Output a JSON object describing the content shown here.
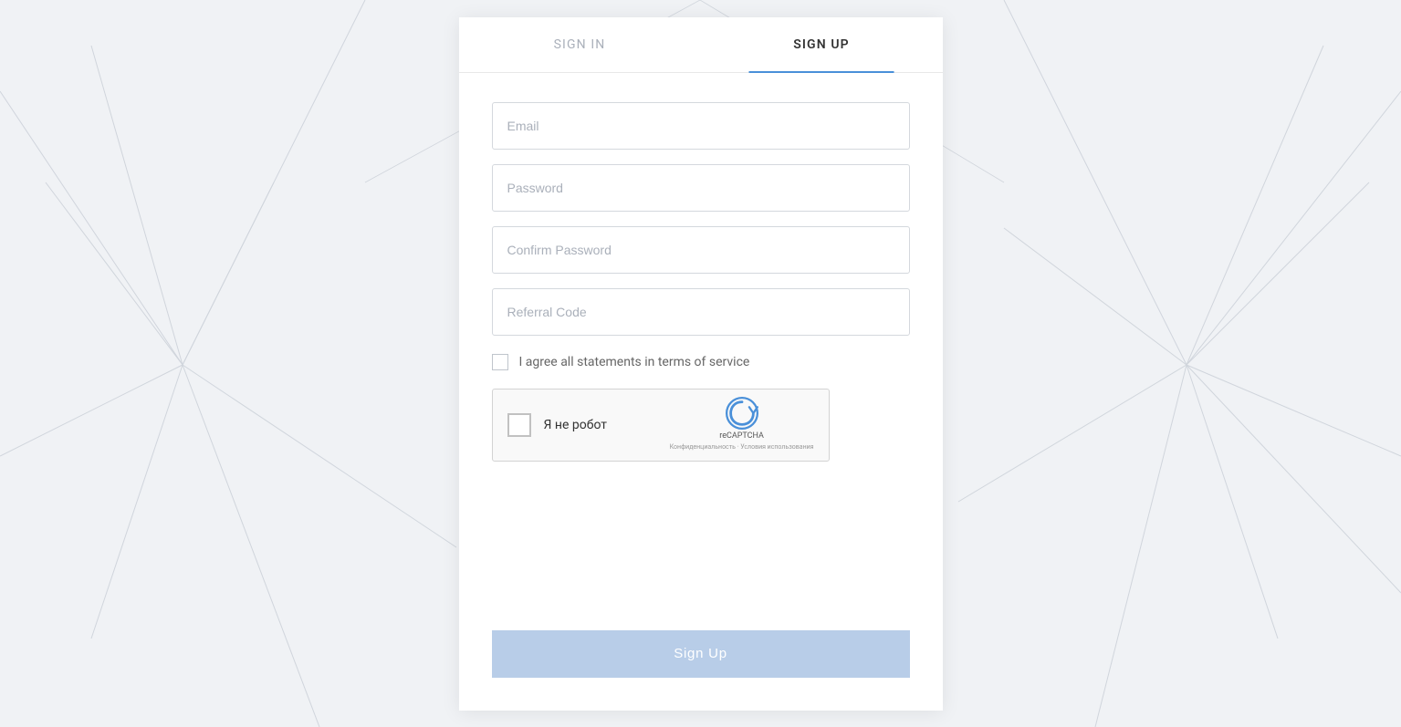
{
  "background": {
    "color": "#f0f2f5"
  },
  "tabs": {
    "signin": {
      "label": "SIGN IN",
      "active": false
    },
    "signup": {
      "label": "SIGN UP",
      "active": true
    }
  },
  "form": {
    "email_placeholder": "Email",
    "password_placeholder": "Password",
    "confirm_password_placeholder": "Confirm Password",
    "referral_code_placeholder": "Referral Code",
    "terms_label": "I agree all statements in terms of service",
    "recaptcha_label": "Я не робот",
    "recaptcha_brand": "reCAPTCHA",
    "recaptcha_subtext": "Конфиденциальность · Условия использования",
    "signup_button_label": "Sign Up"
  }
}
